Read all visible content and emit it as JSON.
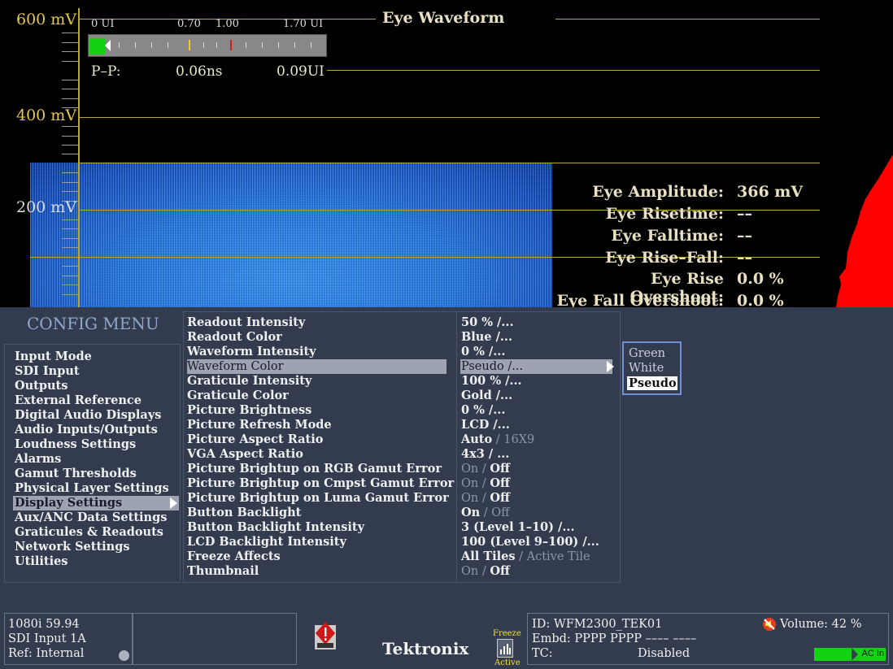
{
  "waveform": {
    "title": "Eye Waveform",
    "voltage_labels": [
      "600 mV",
      "400 mV",
      "200 mV"
    ],
    "gauge": {
      "labels": [
        "0 UI",
        "0.70",
        "1.00",
        "1.70 UI"
      ],
      "pp_label": "P–P:",
      "pp_ns": "0.06ns",
      "pp_ui": "0.09UI"
    },
    "readouts": [
      {
        "label": "Eye Amplitude:",
        "value": "366 mV"
      },
      {
        "label": "Eye Risetime:",
        "value": "––"
      },
      {
        "label": "Eye Falltime:",
        "value": "––"
      },
      {
        "label": "Eye Rise–Fall:",
        "value": "––"
      },
      {
        "label": "Eye Rise Overshoot:",
        "value": "0.0 %"
      },
      {
        "label": "Eye Fall Overshoot:",
        "value": "0.0 %"
      }
    ]
  },
  "config_menu": {
    "title": "CONFIG MENU",
    "categories": [
      "Input Mode",
      "SDI Input",
      "Outputs",
      "External Reference",
      "Digital Audio Displays",
      "Audio Inputs/Outputs",
      "Loudness Settings",
      "Alarms",
      "Gamut Thresholds",
      "Physical Layer Settings",
      "Display Settings",
      "Aux/ANC Data Settings",
      "Graticules & Readouts",
      "Network Settings",
      "Utilities"
    ],
    "selected_category": "Display Settings",
    "items": [
      {
        "label": "Readout Intensity",
        "value": "50 %  /..."
      },
      {
        "label": "Readout Color",
        "value": "Blue /..."
      },
      {
        "label": "Waveform Intensity",
        "value": " 0 %  /..."
      },
      {
        "label": "Waveform Color",
        "value": "Pseudo /..."
      },
      {
        "label": "Graticule Intensity",
        "value": "100 %  /..."
      },
      {
        "label": "Graticule Color",
        "value": "Gold /..."
      },
      {
        "label": "Picture Brightness",
        "value": " 0 %  /..."
      },
      {
        "label": "Picture Refresh Mode",
        "value": "LCD /..."
      },
      {
        "label": "Picture Aspect Ratio",
        "value": "Auto",
        "value_dim": " / 16X9"
      },
      {
        "label": "VGA Aspect Ratio",
        "value": "4x3 / ..."
      },
      {
        "label": "Picture Brightup on RGB Gamut Error",
        "value_dim_pre": "On / ",
        "value": "Off"
      },
      {
        "label": "Picture Brightup on Cmpst Gamut Error",
        "value_dim_pre": "On / ",
        "value": "Off"
      },
      {
        "label": "Picture Brightup on Luma Gamut Error",
        "value_dim_pre": "On / ",
        "value": "Off"
      },
      {
        "label": "Button Backlight",
        "value": "On",
        "value_dim": " / Off"
      },
      {
        "label": "Button Backlight Intensity",
        "value": " 3 (Level 1–10) /..."
      },
      {
        "label": "LCD Backlight Intensity",
        "value": "100 (Level 9–100) /..."
      },
      {
        "label": "Freeze Affects",
        "value": "All Tiles",
        "value_dim": " / Active Tile"
      },
      {
        "label": "Thumbnail",
        "value_dim_pre": "On / ",
        "value": "Off"
      }
    ],
    "selected_item": "Waveform Color",
    "submenu": [
      "Green",
      "White",
      "Pseudo"
    ],
    "submenu_selected": "Pseudo"
  },
  "status_bar": {
    "format": "1080i 59.94",
    "input": "SDI Input 1A",
    "ref": "Ref: Internal",
    "brand": "Tektronix",
    "freeze": "Freeze",
    "active": "Active",
    "id": "ID: WFM2300_TEK01",
    "embd": "Embd: PPPP PPPP –––– ––––",
    "tc_label": "TC:",
    "tc_value": "Disabled",
    "volume": "Volume:  42 %",
    "ac": "AC In"
  },
  "colors": {
    "graticule": "#b9a838",
    "menu_bg": "#333c4e",
    "accent_green": "#16d016",
    "histogram": "#ff0000"
  }
}
